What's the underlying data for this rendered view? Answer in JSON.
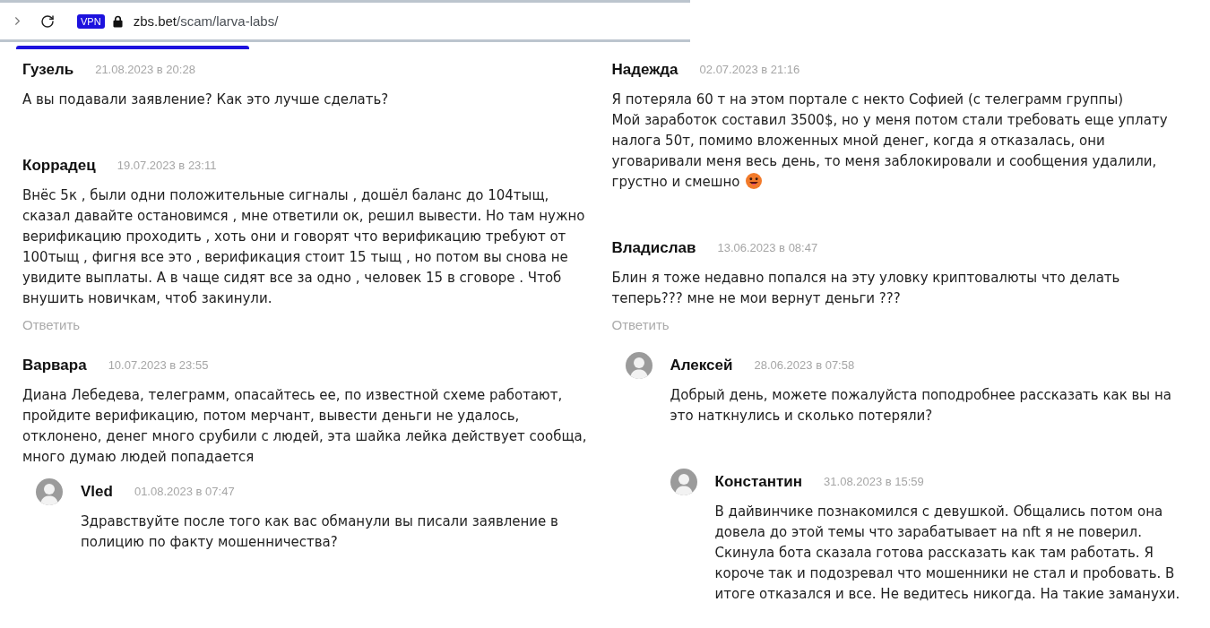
{
  "browser": {
    "vpn_badge": "VPN",
    "url": {
      "host": "zbs.bet",
      "path": "/scam/larva-labs/"
    }
  },
  "columns": [
    {
      "comments": [
        {
          "author": "Гузель",
          "date": "21.08.2023 в 20:28",
          "text": "А вы подавали заявление? Как это лучше сделать?"
        },
        {
          "author": "Коррадец",
          "date": "19.07.2023 в 23:11",
          "text": "Внёс 5к , были одни положительные сигналы , дошёл баланс до 104тыщ, сказал давайте остановимся , мне ответили ок, решил вывести. Но там нужно верификацию проходить , хоть они и говорят что верификацию требуют от 100тыщ , фигня все это , верификация стоит 15 тыщ , но потом вы снова не увидите выплаты. А в чаще сидят все за одно , человек 15 в сговоре . Чтоб внушить новичкам, чтоб закинули.",
          "reply_link": "Ответить"
        },
        {
          "author": "Варвара",
          "date": "10.07.2023 в 23:55",
          "text": "Диана Лебедева, телеграмм, опасайтесь ее, по известной схеме работают, пройдите верификацию, потом мерчант, вывести деньги не удалось, отклонено, денег много срубили с людей, эта шайка лейка действует сообща, много думаю людей попадается",
          "children": [
            {
              "author": "Vled",
              "date": "01.08.2023 в 07:47",
              "text": "Здравствуйте после того как вас обманули вы писали заявление в полицию по факту мошенничества?"
            }
          ]
        }
      ]
    },
    {
      "comments": [
        {
          "author": "Надежда",
          "date": "02.07.2023 в 21:16",
          "text": "Я потеряла 60 т на этом портале с некто Софией (с телеграмм группы)\nМой заработок составил 3500$, но у меня потом стали требовать еще уплату налога 50т, помимо вложенных мной денег, когда я отказалась, они уговаривали меня весь день, то меня заблокировали и сообщения удалили, грустно и смешно",
          "emoji": true
        },
        {
          "author": "Владислав",
          "date": "13.06.2023 в 08:47",
          "text": "Блин я тоже недавно попался на эту уловку криптовалюты что делать теперь??? мне не мои вернут деньги ???",
          "reply_link": "Ответить",
          "children": [
            {
              "author": "Алексей",
              "date": "28.06.2023 в 07:58",
              "text": "Добрый день, можете пожалуйста поподробнее рассказать как вы на это наткнулись и сколько потеряли?",
              "children": [
                {
                  "author": "Константин",
                  "date": "31.08.2023 в 15:59",
                  "text": "В дайвинчике познакомился с девушкой. Общались потом она довела до этой темы что зарабатывает на nft я не поверил. Скинула бота сказала готова рассказать как там работать. Я короче так и подозревал что мошенники не стал и пробовать. В итоге отказался и все. Не ведитесь никогда. На такие заманухи."
                }
              ]
            }
          ]
        }
      ]
    }
  ]
}
